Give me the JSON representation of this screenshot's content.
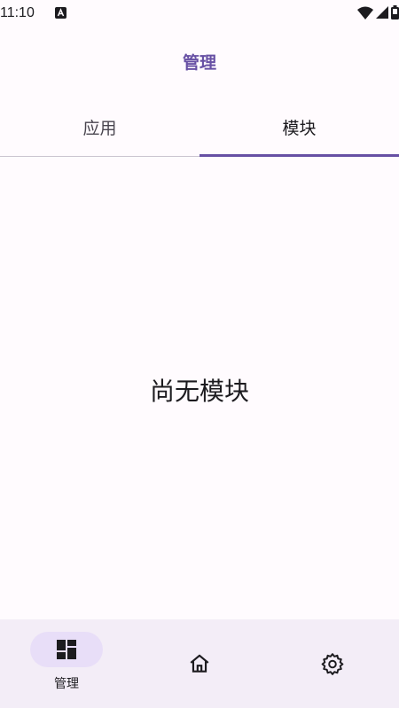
{
  "status_bar": {
    "time": "11:10",
    "icons": [
      "notification-a-icon",
      "wifi-icon",
      "signal-icon",
      "battery-icon"
    ]
  },
  "app_bar": {
    "title": "管理"
  },
  "tabs": [
    {
      "label": "应用",
      "active": false
    },
    {
      "label": "模块",
      "active": true
    }
  ],
  "empty_state": {
    "message": "尚无模块"
  },
  "bottom_nav": {
    "items": [
      {
        "label": "管理",
        "icon": "dashboard-icon",
        "active": true
      },
      {
        "label": "",
        "icon": "home-icon",
        "active": false
      },
      {
        "label": "",
        "icon": "settings-icon",
        "active": false
      }
    ]
  },
  "colors": {
    "accent": "#6750a4",
    "background": "#fffbfe",
    "nav_background": "#f3edf7",
    "active_pill": "#e8def8"
  }
}
